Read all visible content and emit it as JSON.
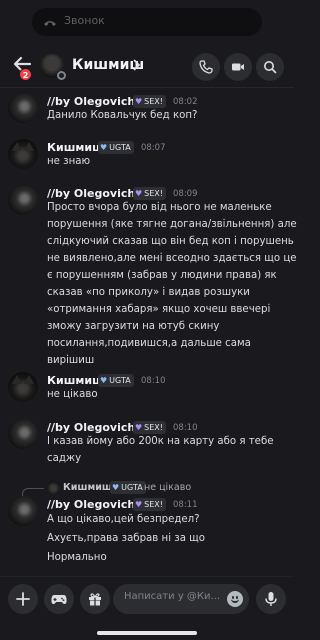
{
  "call_pill": {
    "label": "Звонок"
  },
  "header": {
    "title": "Кишмиш",
    "unread_badge": "2"
  },
  "tags": {
    "sex": "SEX!",
    "ugta": "UGTA"
  },
  "messages": [
    {
      "author": "//by Olegovich\\\\",
      "tag": "SEX!",
      "time": "08:02",
      "lines": [
        "Данило Ковальчук бед коп?"
      ]
    },
    {
      "author": "Кишмиш",
      "tag": "UGTA",
      "time": "08:07",
      "lines": [
        "не знаю"
      ]
    },
    {
      "author": "//by Olegovich\\\\",
      "tag": "SEX!",
      "time": "08:09",
      "lines": [
        "Просто вчора було від нього не маленьке",
        "порушення (яке тягне догана/звільнення) але",
        "слідкуючий сказав що він бед коп і порушень",
        "не виявлено,але мені всеодно здається що це",
        "є порушенням (забрав у людини права) як",
        "сказав «по приколу» і видав розшуки",
        "«отримання хабаря» якщо хочеш ввечері",
        "зможу загрузити на ютуб скину",
        "посилання,подивишся,а дальше сама",
        "вирішиш"
      ]
    },
    {
      "author": "Кишмиш",
      "tag": "UGTA",
      "time": "08:10",
      "lines": [
        "не цікаво"
      ]
    },
    {
      "author": "//by Olegovich\\\\",
      "tag": "SEX!",
      "time": "08:10",
      "lines": [
        "І казав йому або 200к на карту або я тебе",
        "саджу"
      ]
    },
    {
      "author": "//by Olegovich\\\\",
      "tag": "SEX!",
      "time": "08:11",
      "lines": [
        "А що цікаво,цей безпредел?",
        "Ахуєть,права забрав ні за що",
        "Нормально"
      ],
      "reply": {
        "author": "Кишмиш",
        "tag": "UGTA",
        "text": "не цікаво"
      }
    }
  ],
  "composer": {
    "placeholder": "Написати у @Ки..."
  }
}
